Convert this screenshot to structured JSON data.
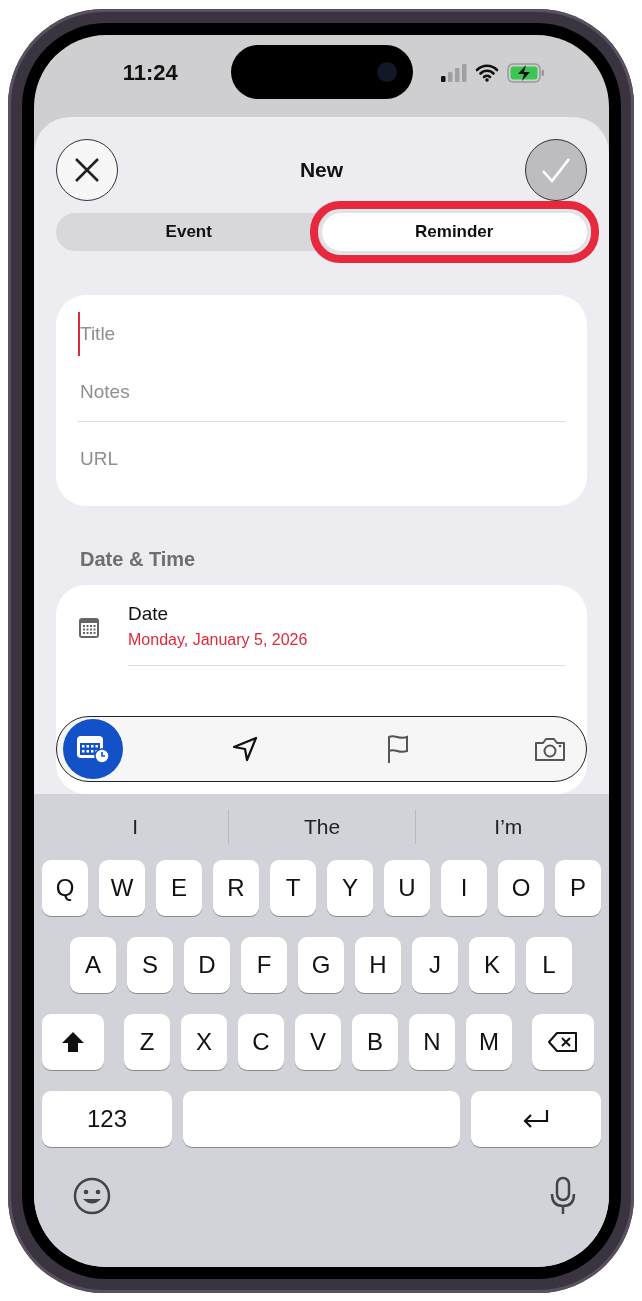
{
  "status_bar": {
    "time": "11:24"
  },
  "header": {
    "title": "New"
  },
  "segments": [
    {
      "label": "Event",
      "selected": false,
      "highlighted": false
    },
    {
      "label": "Reminder",
      "selected": true,
      "highlighted": true
    }
  ],
  "fields": [
    {
      "placeholder": "Title",
      "focused": true
    },
    {
      "placeholder": "Notes",
      "focused": false
    },
    {
      "placeholder": "URL",
      "focused": false
    }
  ],
  "section_title": "Date & Time",
  "date_row": {
    "label": "Date",
    "value": "Monday, January 5, 2026"
  },
  "toolbar": [
    {
      "kind": "date",
      "selected": true
    },
    {
      "kind": "location",
      "selected": false
    },
    {
      "kind": "flag",
      "selected": false
    },
    {
      "kind": "camera",
      "selected": false
    }
  ],
  "suggestions": [
    "I",
    "The",
    "I’m"
  ],
  "keyboard": {
    "rows": [
      [
        {
          "kind": "letter",
          "label": "Q"
        },
        {
          "kind": "letter",
          "label": "W"
        },
        {
          "kind": "letter",
          "label": "E"
        },
        {
          "kind": "letter",
          "label": "R"
        },
        {
          "kind": "letter",
          "label": "T"
        },
        {
          "kind": "letter",
          "label": "Y"
        },
        {
          "kind": "letter",
          "label": "U"
        },
        {
          "kind": "letter",
          "label": "I"
        },
        {
          "kind": "letter",
          "label": "O"
        },
        {
          "kind": "letter",
          "label": "P"
        }
      ],
      [
        {
          "kind": "letter",
          "label": "A"
        },
        {
          "kind": "letter",
          "label": "S"
        },
        {
          "kind": "letter",
          "label": "D"
        },
        {
          "kind": "letter",
          "label": "F"
        },
        {
          "kind": "letter",
          "label": "G"
        },
        {
          "kind": "letter",
          "label": "H"
        },
        {
          "kind": "letter",
          "label": "J"
        },
        {
          "kind": "letter",
          "label": "K"
        },
        {
          "kind": "letter",
          "label": "L"
        }
      ],
      [
        {
          "kind": "shift"
        },
        {
          "kind": "letter",
          "label": "Z"
        },
        {
          "kind": "letter",
          "label": "X"
        },
        {
          "kind": "letter",
          "label": "C"
        },
        {
          "kind": "letter",
          "label": "V"
        },
        {
          "kind": "letter",
          "label": "B"
        },
        {
          "kind": "letter",
          "label": "N"
        },
        {
          "kind": "letter",
          "label": "M"
        },
        {
          "kind": "delete"
        }
      ],
      [
        {
          "kind": "numbers",
          "label": "123"
        },
        {
          "kind": "space"
        },
        {
          "kind": "return"
        }
      ]
    ]
  }
}
